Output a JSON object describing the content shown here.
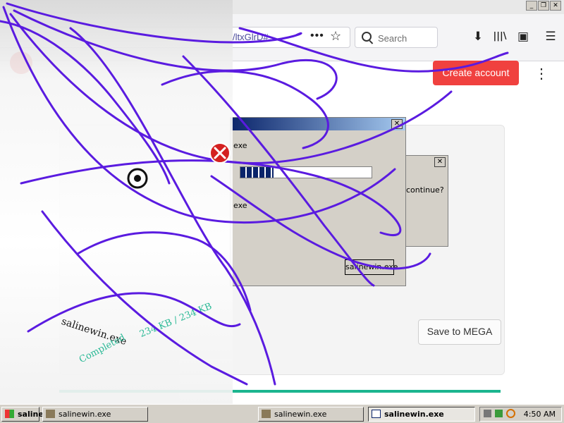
{
  "browser": {
    "url_fragment": "/ltxGlrD#",
    "search_placeholder": "Search",
    "more_glyph": "•••",
    "star_glyph": "☆",
    "download_glyph": "⬇",
    "library_glyph": "|||\\",
    "sidebar_glyph": "▣",
    "menu_glyph": "☰"
  },
  "page": {
    "create_account_label": "Create account",
    "kebab_glyph": "⋮",
    "save_to_mega_label": "Save to MEGA",
    "download_progress": 1.0,
    "accent_red": "#f0413f",
    "progress_green": "#1bb58f",
    "glitch_texts": [
      "salinewin.exe",
      "234 KB / 234 KB",
      "Completed"
    ]
  },
  "dialogs": {
    "main": {
      "close_glyph": "✕",
      "line1": "exe",
      "line2": "exe",
      "progress": 0.25,
      "button_label": "salinewin.exe"
    },
    "back": {
      "close_glyph": "✕",
      "message": "continue?"
    }
  },
  "taskbar": {
    "start_label": "saline",
    "tasks": [
      {
        "label": "salinewin.exe",
        "active": false
      },
      {
        "label": "salinewin.exe",
        "active": false
      },
      {
        "label": "salinewin.exe",
        "active": true
      }
    ],
    "clock": "4:50 AM"
  },
  "window_controls": {
    "minimize": "_",
    "restore": "❐",
    "close": "✕"
  }
}
